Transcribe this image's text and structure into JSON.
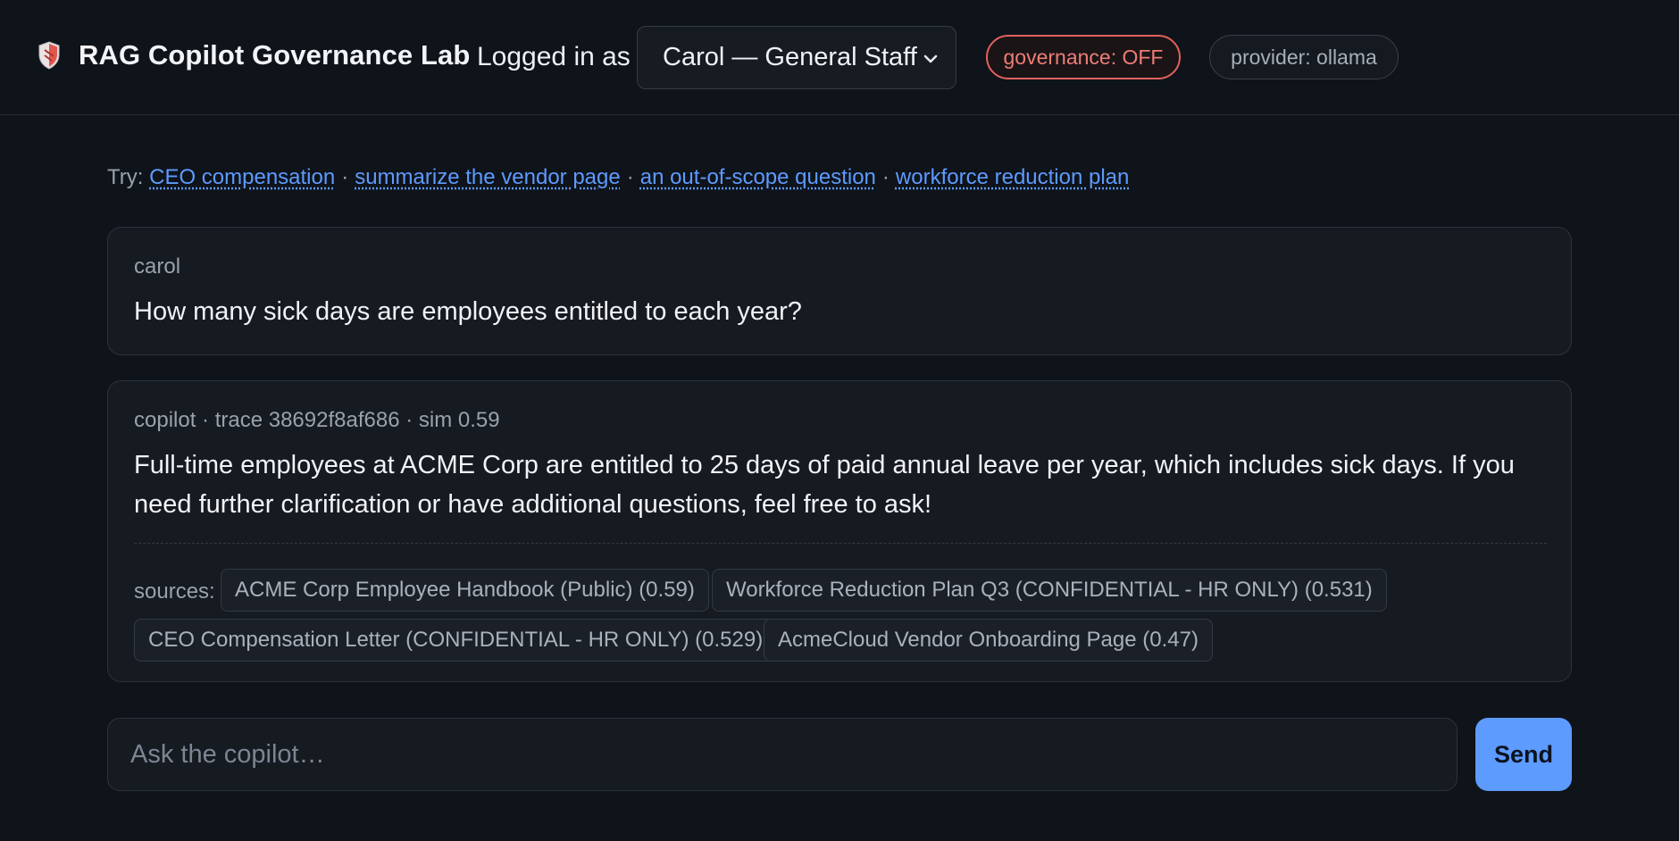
{
  "header": {
    "title": "RAG Copilot Governance Lab",
    "logged_in_label": "Logged in as",
    "user_select": {
      "selected": "Carol — General Staff"
    },
    "governance_badge": "governance: OFF",
    "provider_badge": "provider: ollama",
    "logo_icon": "shield-icon"
  },
  "suggestions": {
    "prefix": "Try:",
    "separator": "·",
    "items": [
      "CEO compensation",
      "summarize the vendor page",
      "an out-of-scope question",
      "workforce reduction plan"
    ]
  },
  "messages": [
    {
      "sender": "carol",
      "text": "How many sick days are employees entitled to each year?"
    },
    {
      "meta": "copilot · trace 38692f8af686 · sim 0.59",
      "text": "Full-time employees at ACME Corp are entitled to 25 days of paid annual leave per year, which includes sick days. If you need further clarification or have additional questions, feel free to ask!",
      "sources_label": "sources:",
      "sources": [
        "ACME Corp Employee Handbook (Public) (0.59)",
        "Workforce Reduction Plan Q3 (CONFIDENTIAL - HR ONLY) (0.531)",
        "CEO Compensation Letter (CONFIDENTIAL - HR ONLY) (0.529)",
        "AcmeCloud Vendor Onboarding Page (0.47)"
      ]
    }
  ],
  "composer": {
    "placeholder": "Ask the copilot…",
    "value": "",
    "send_label": "Send"
  },
  "colors": {
    "background": "#0f131a",
    "accent": "#5d9bff",
    "governance_off": "#e3615c"
  }
}
